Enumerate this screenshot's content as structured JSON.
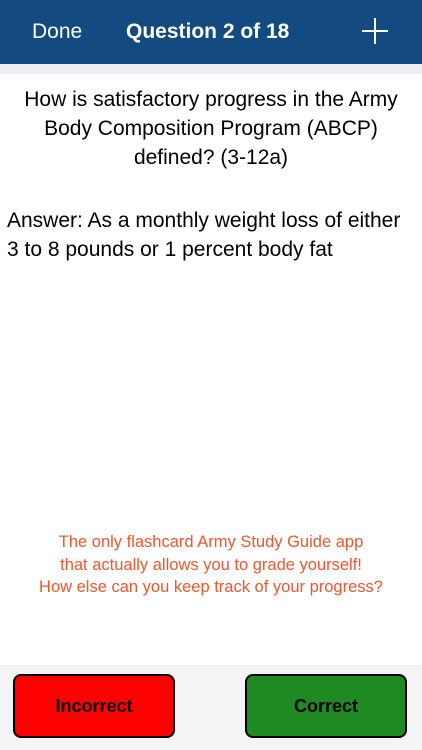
{
  "nav": {
    "done_label": "Done",
    "title": "Question 2 of 18",
    "add_icon": "plus-icon"
  },
  "card": {
    "question": "How is satisfactory progress in the Army Body Composition Program (ABCP) defined? (3-12a)",
    "answer": "Answer: As a monthly weight loss of either 3 to 8 pounds or 1 percent body fat"
  },
  "promo": {
    "line1": "The only flashcard Army Study Guide app",
    "line2": "that actually allows you to grade yourself!",
    "line3": "How else can you keep track of your progress?"
  },
  "buttons": {
    "incorrect_label": "Incorrect",
    "correct_label": "Correct"
  },
  "colors": {
    "nav_background": "#134a7f",
    "promo_text": "#f2552a",
    "incorrect_button": "#ff0000",
    "correct_button": "#1f8a22"
  }
}
